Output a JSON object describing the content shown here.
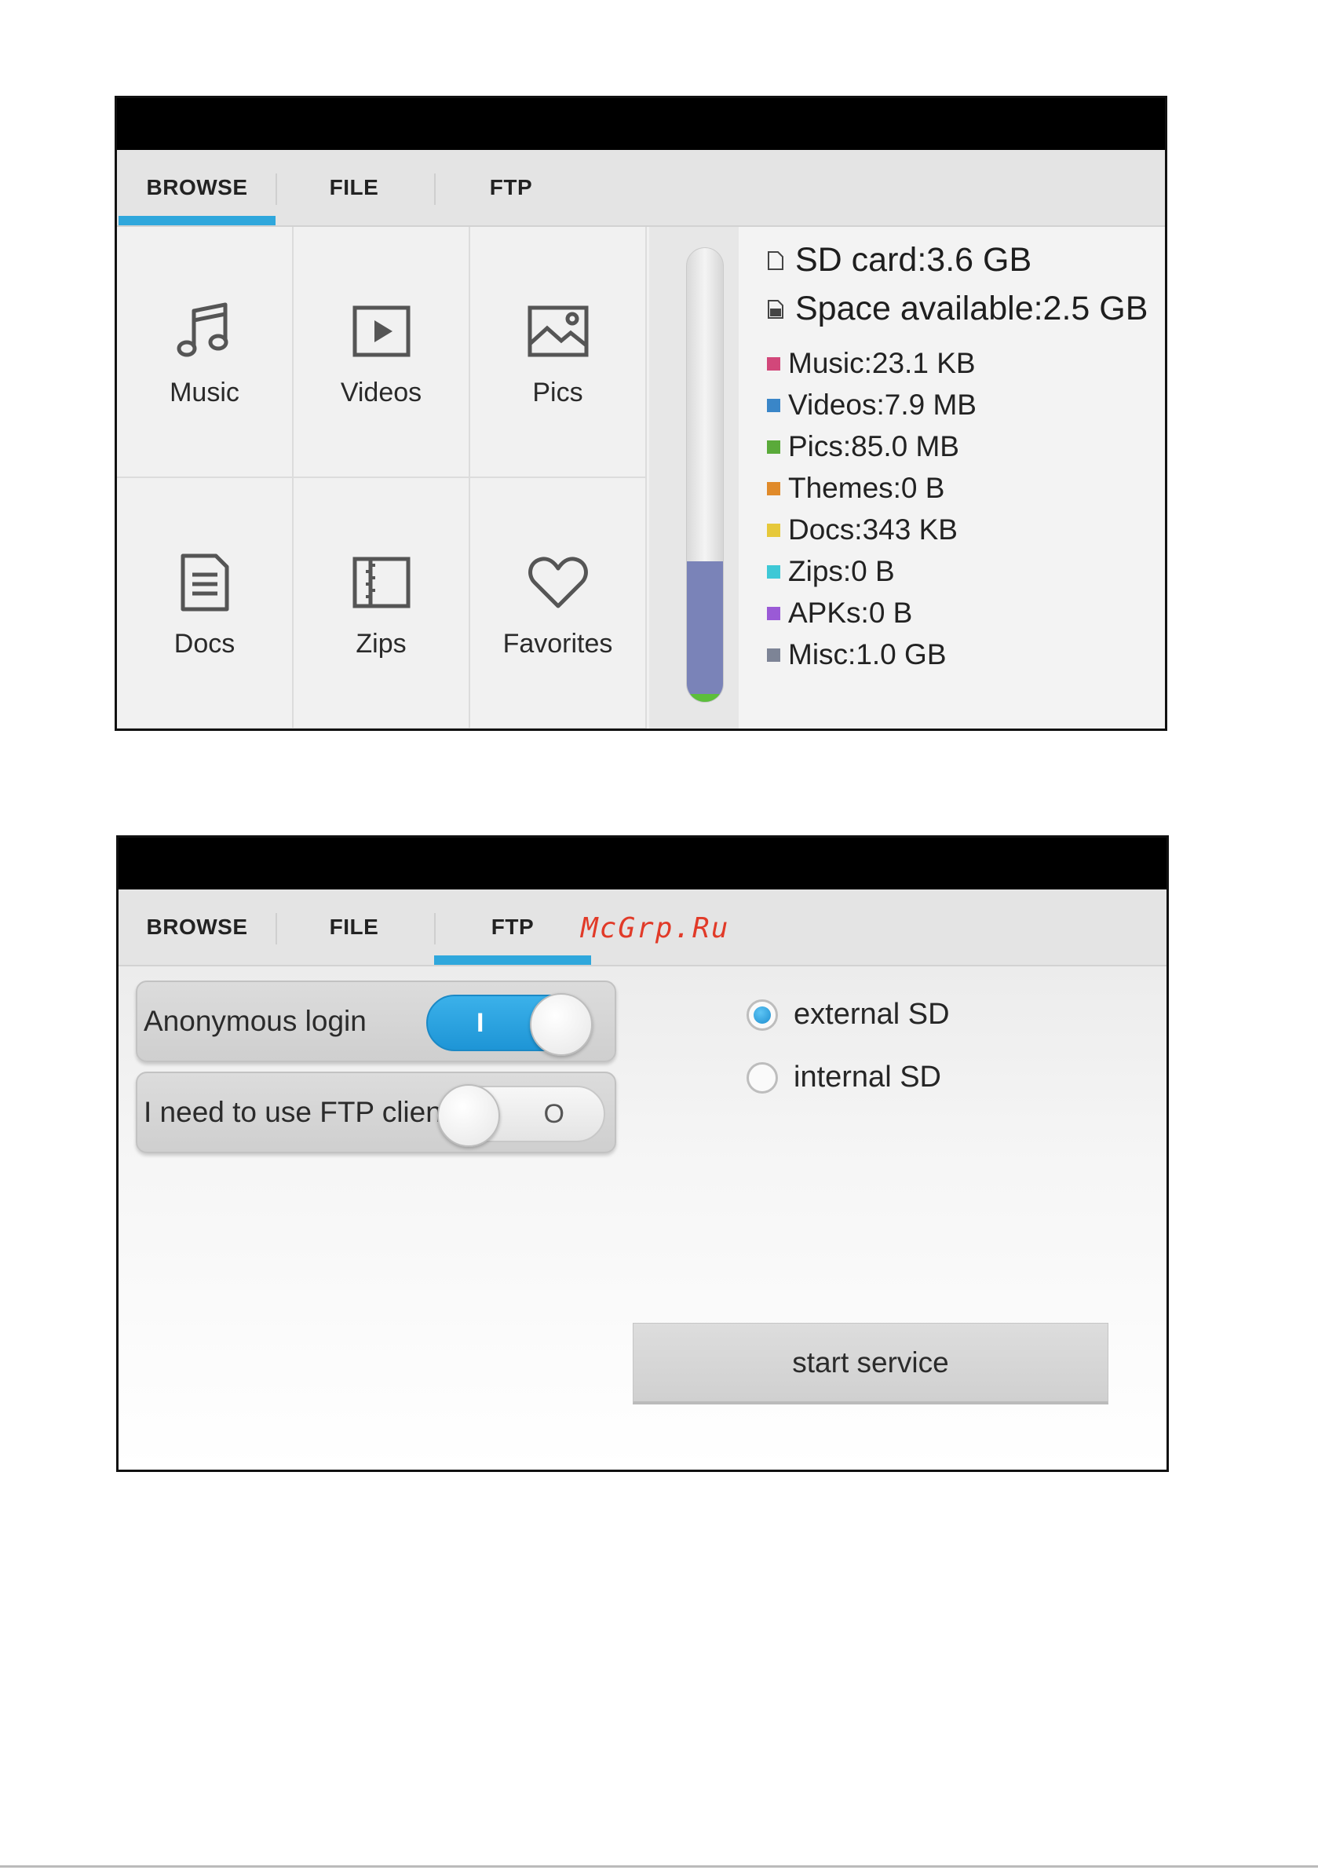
{
  "tabs": [
    "BROWSE",
    "FILE",
    "FTP"
  ],
  "browse": {
    "categories": [
      {
        "label": "Music",
        "icon": "music-icon"
      },
      {
        "label": "Videos",
        "icon": "video-icon"
      },
      {
        "label": "Pics",
        "icon": "picture-icon"
      },
      {
        "label": "Docs",
        "icon": "document-icon"
      },
      {
        "label": "Zips",
        "icon": "zip-icon"
      },
      {
        "label": "Favorites",
        "icon": "heart-icon"
      }
    ],
    "storage_used_fraction": 0.31,
    "sd_card": "SD card:3.6 GB",
    "space_available": "Space available:2.5 GB",
    "breakdown": [
      {
        "label": "Music:23.1 KB",
        "color": "#d2477a"
      },
      {
        "label": "Videos:7.9 MB",
        "color": "#3a86c8"
      },
      {
        "label": "Pics:85.0 MB",
        "color": "#5aaa3a"
      },
      {
        "label": "Themes:0 B",
        "color": "#e08a2a"
      },
      {
        "label": "Docs:343 KB",
        "color": "#e6c83a"
      },
      {
        "label": "Zips:0 B",
        "color": "#3ec8d6"
      },
      {
        "label": "APKs:0 B",
        "color": "#9a5ad6"
      },
      {
        "label": "Misc:1.0 GB",
        "color": "#7d8496"
      }
    ]
  },
  "ftp": {
    "anonymous_login": {
      "label": "Anonymous login",
      "state": "on",
      "mark": "I"
    },
    "ftp_client": {
      "label": "I need to use FTP client",
      "state": "off",
      "mark": "O"
    },
    "storage_options": [
      {
        "label": "external SD",
        "checked": true
      },
      {
        "label": "internal SD",
        "checked": false
      }
    ],
    "start_button": "start service"
  },
  "watermark": "McGrp.Ru",
  "colors": {
    "accent": "#2fa7dc",
    "toggle_on": "#1e95d6",
    "watermark": "#e13a28"
  }
}
